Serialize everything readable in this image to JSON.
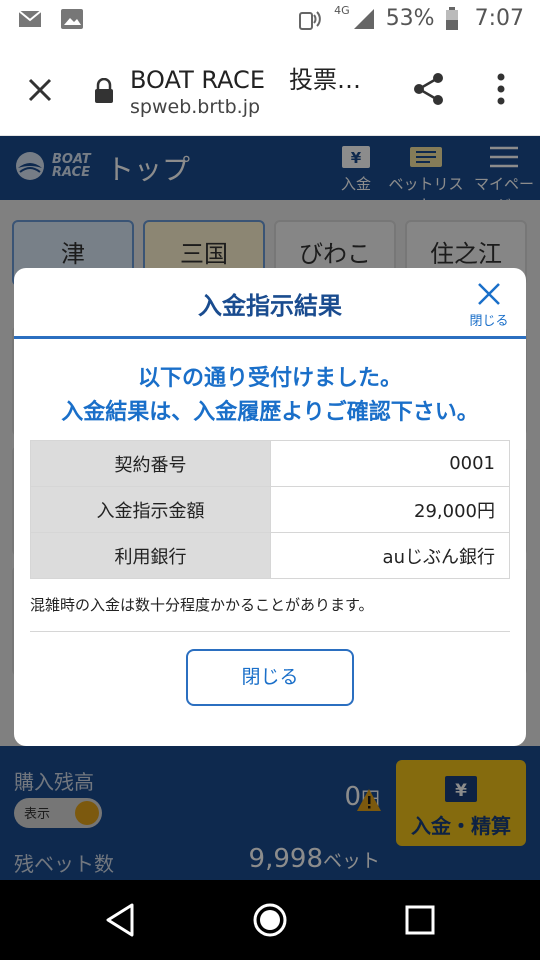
{
  "status_bar": {
    "network": "4G",
    "battery": "53%",
    "time": "7:07"
  },
  "browser": {
    "page_title": "BOAT RACE　投票…",
    "url": "spweb.brtb.jp"
  },
  "app_header": {
    "logo_line1": "BOAT",
    "logo_line2": "RACE",
    "title": "トップ",
    "buttons": {
      "deposit": "入金",
      "bet_list": "ベットリスト",
      "my_page": "マイページ"
    }
  },
  "race_tiles": [
    "津",
    "三国",
    "びわこ",
    "住之江"
  ],
  "modal": {
    "title": "入金指示結果",
    "close_label": "閉じる",
    "message_line1": "以下の通り受付けました。",
    "message_line2": "入金結果は、入金履歴よりご確認下さい。",
    "rows": [
      {
        "label": "契約番号",
        "value": "0001"
      },
      {
        "label": "入金指示金額",
        "value": "29,000円"
      },
      {
        "label": "利用銀行",
        "value": "auじぶん銀行"
      }
    ],
    "note": "混雑時の入金は数十分程度かかることがあります。",
    "close_button": "閉じる"
  },
  "bottom_panel": {
    "balance_label": "購入残高",
    "toggle_label": "表示",
    "balance_value": "0",
    "balance_unit": "円",
    "bets_label": "残ベット数",
    "bets_value": "9,998",
    "bets_unit": "ベット",
    "deposit_button": "入金・精算"
  },
  "colors": {
    "brand_blue": "#1a4c8f",
    "accent_blue": "#1a6fc9",
    "deposit_yellow": "#f2c41b"
  }
}
